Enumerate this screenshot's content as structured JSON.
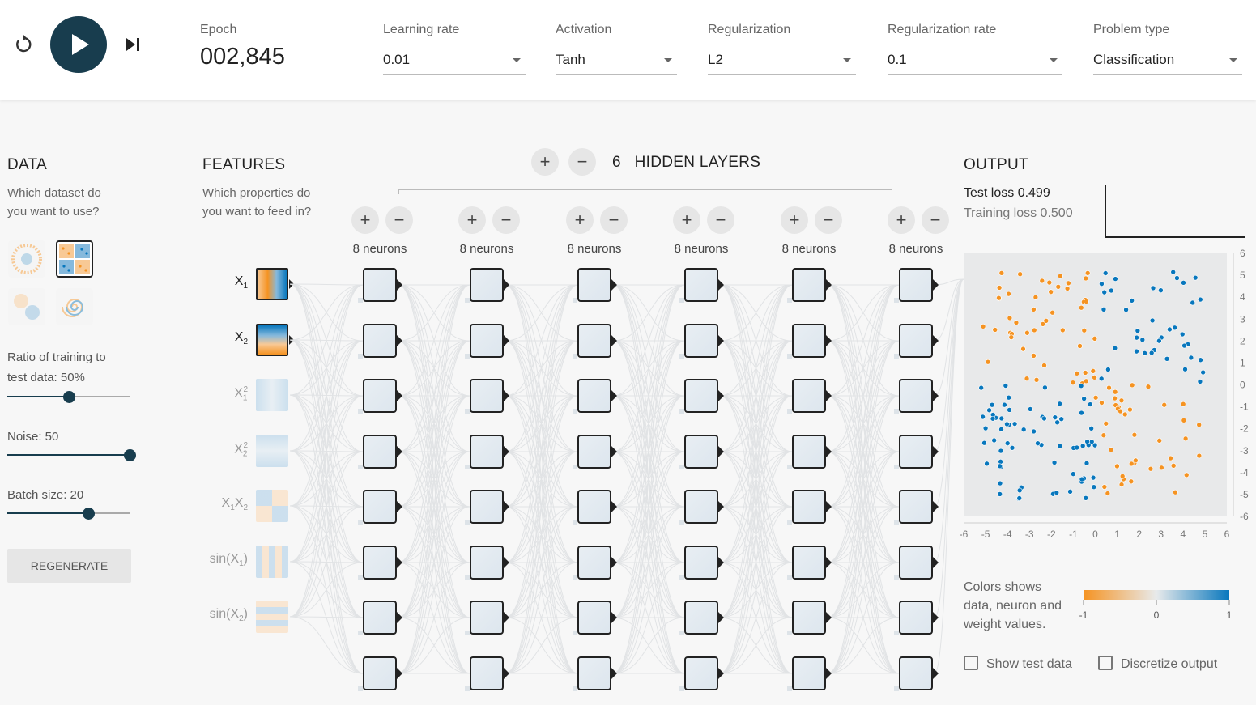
{
  "controls": {
    "reset_icon": "reset-icon",
    "play_icon": "play-icon",
    "step_icon": "step-icon",
    "epoch_label": "Epoch",
    "epoch_value": "002,845",
    "learning_rate_label": "Learning rate",
    "learning_rate_value": "0.01",
    "activation_label": "Activation",
    "activation_value": "Tanh",
    "regularization_label": "Regularization",
    "regularization_value": "L2",
    "regularization_rate_label": "Regularization rate",
    "regularization_rate_value": "0.1",
    "problem_type_label": "Problem type",
    "problem_type_value": "Classification"
  },
  "data_panel": {
    "title": "DATA",
    "subtitle_line1": "Which dataset do",
    "subtitle_line2": "you want to use?",
    "datasets": [
      "circle",
      "xor",
      "gaussian",
      "spiral"
    ],
    "selected_dataset": "xor",
    "ratio_label_line1": "Ratio of training to",
    "ratio_label_line2": "test data:  50%",
    "ratio_value": 0.5,
    "noise_label": "Noise:  50",
    "noise_value": 1.0,
    "batch_label": "Batch size:  20",
    "batch_value": 0.66,
    "regenerate_label": "REGENERATE"
  },
  "features_panel": {
    "title": "FEATURES",
    "subtitle_line1": "Which properties do",
    "subtitle_line2": "you want to feed in?",
    "features": [
      {
        "name": "X1",
        "base": "X",
        "sub": "1",
        "sup": "",
        "pre": "",
        "post": "",
        "active": true
      },
      {
        "name": "X2",
        "base": "X",
        "sub": "2",
        "sup": "",
        "pre": "",
        "post": "",
        "active": true
      },
      {
        "name": "X1^2",
        "base": "X",
        "sub": "1",
        "sup": "2",
        "pre": "",
        "post": "",
        "active": false
      },
      {
        "name": "X2^2",
        "base": "X",
        "sub": "2",
        "sup": "2",
        "pre": "",
        "post": "",
        "active": false
      },
      {
        "name": "X1X2",
        "base": "X",
        "sub": "1",
        "sup": "",
        "pre": "",
        "post": "X2",
        "active": false
      },
      {
        "name": "sin(X1)",
        "base": "X",
        "sub": "1",
        "sup": "",
        "pre": "sin(",
        "post": ")",
        "active": false
      },
      {
        "name": "sin(X2)",
        "base": "X",
        "sub": "2",
        "sup": "",
        "pre": "sin(",
        "post": ")",
        "active": false
      }
    ]
  },
  "network": {
    "hidden_layers_count": "6",
    "hidden_layers_label": "HIDDEN LAYERS",
    "add_layer_icon": "plus-icon",
    "remove_layer_icon": "minus-icon",
    "layers": [
      {
        "neurons": 8,
        "label": "8 neurons"
      },
      {
        "neurons": 8,
        "label": "8 neurons"
      },
      {
        "neurons": 8,
        "label": "8 neurons"
      },
      {
        "neurons": 8,
        "label": "8 neurons"
      },
      {
        "neurons": 8,
        "label": "8 neurons"
      },
      {
        "neurons": 8,
        "label": "8 neurons"
      }
    ]
  },
  "output_panel": {
    "title": "OUTPUT",
    "test_loss": "Test loss 0.499",
    "training_loss": "Training loss 0.500",
    "x_ticks": [
      "-6",
      "-5",
      "-4",
      "-3",
      "-2",
      "-1",
      "0",
      "1",
      "2",
      "3",
      "4",
      "5",
      "6"
    ],
    "y_ticks": [
      "6",
      "5",
      "4",
      "3",
      "2",
      "1",
      "0",
      "-1",
      "-2",
      "-3",
      "-4",
      "-5",
      "-6"
    ],
    "legend_line1": "Colors shows",
    "legend_line2": "data, neuron and",
    "legend_line3": "weight values.",
    "legend_min": "-1",
    "legend_mid": "0",
    "legend_max": "1",
    "show_test_label": "Show test data",
    "discretize_label": "Discretize output",
    "colors": {
      "orange": "#f59322",
      "blue": "#0877bd",
      "dark": "#183d4e"
    }
  }
}
